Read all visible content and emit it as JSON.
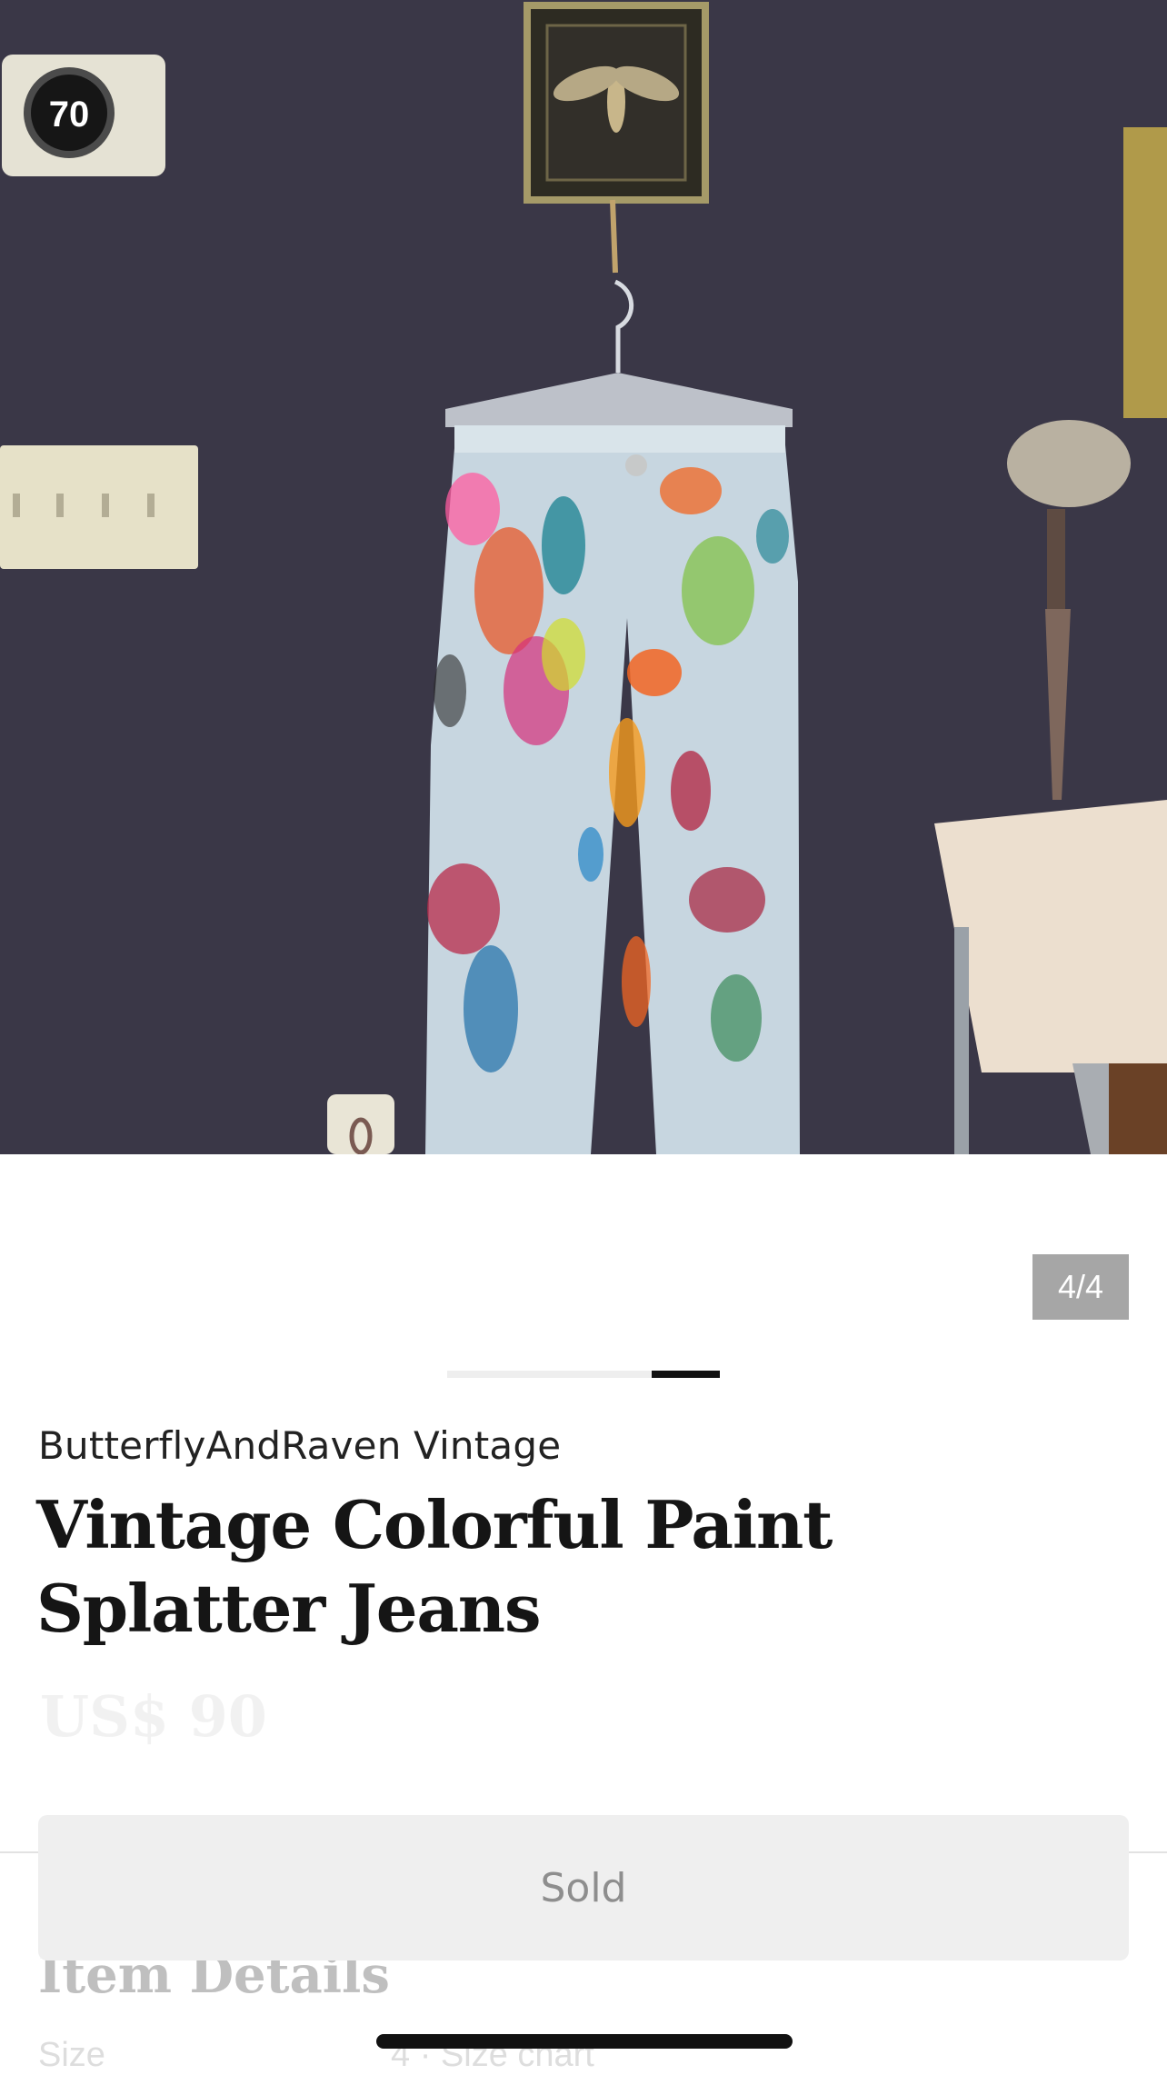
{
  "listing": {
    "image_counter": "4/4",
    "image_progress": 0.25,
    "shop_name": "ButterflyAndRaven Vintage",
    "title": "Vintage Colorful Paint Splatter Jeans",
    "price": "US$ 90",
    "thermostat_reading": "70"
  },
  "actions": {
    "sold_label": "Sold"
  },
  "details": {
    "heading": "Item Details",
    "size_label": "Size",
    "size_value": "4 · Size chart"
  },
  "colors": {
    "wall": "#3a3747",
    "sold_bg": "#efefef",
    "counter_bg": "#a6a6a6",
    "accent": "#111111"
  }
}
